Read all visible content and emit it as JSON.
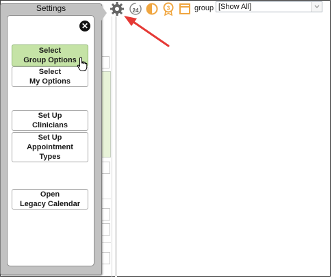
{
  "settings_panel": {
    "title": "Settings",
    "buttons": [
      {
        "line1": "Select",
        "line2": "Group Options",
        "line3": ""
      },
      {
        "line1": "Select",
        "line2": "My Options",
        "line3": ""
      },
      {
        "line1": "Set Up",
        "line2": "Clinicians",
        "line3": ""
      },
      {
        "line1": "Set Up",
        "line2": "Appointment",
        "line3": "Types"
      },
      {
        "line1": "Open",
        "line2": "Legacy Calendar",
        "line3": ""
      }
    ]
  },
  "toolbar": {
    "icons": [
      "gear-icon",
      "24-hour-clock-icon",
      "half-circle-icon",
      "award-3-icon",
      "calendar-icon"
    ],
    "badge_24": "24",
    "badge_3": "3",
    "group_label": "group",
    "group_value": "[Show All]"
  },
  "annotation": {
    "arrow_color": "#e53935"
  },
  "colors": {
    "active_button": "#c5e3a6",
    "panel_bg": "#c2c2c2"
  }
}
